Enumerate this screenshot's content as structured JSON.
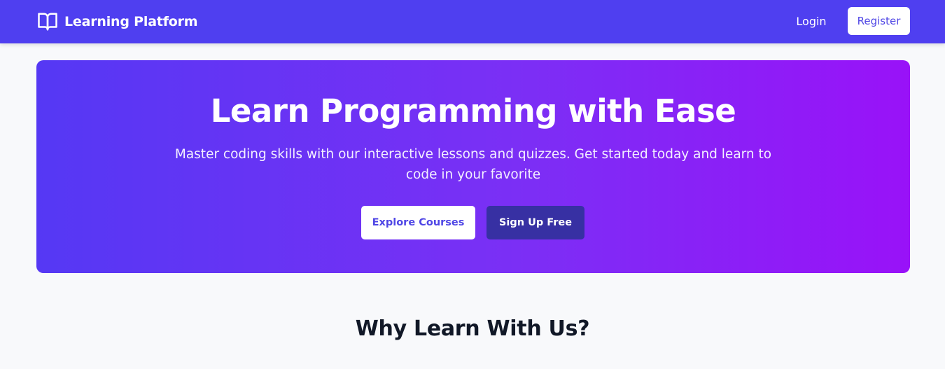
{
  "navbar": {
    "brand_icon": "open-book-icon",
    "brand_name": "Learning Platform",
    "login_label": "Login",
    "register_label": "Register"
  },
  "hero": {
    "title": "Learn Programming with Ease",
    "subtitle": "Master coding skills with our interactive lessons and quizzes. Get started today and learn to code in your favorite",
    "explore_label": "Explore Courses",
    "signup_label": "Sign Up Free"
  },
  "features": {
    "heading": "Why Learn With Us?"
  },
  "colors": {
    "navbar_bg": "#4f3ff0",
    "hero_gradient_start": "#5538f4",
    "hero_gradient_end": "#9912f8",
    "signup_button_bg": "#3730a3",
    "page_bg": "#f8f9fb"
  }
}
